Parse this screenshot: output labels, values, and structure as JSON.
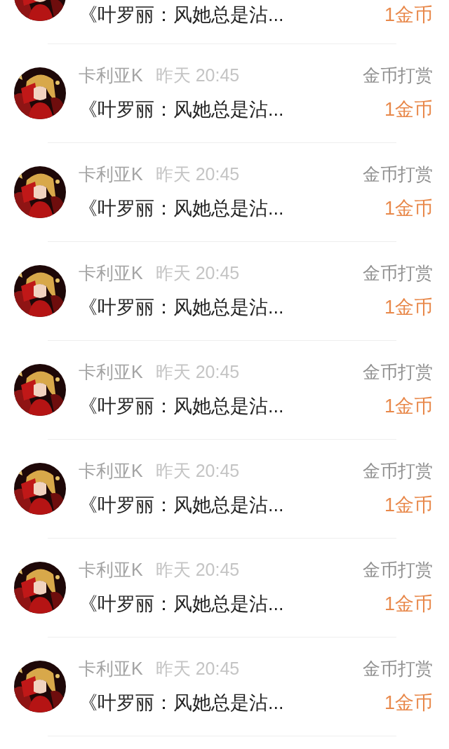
{
  "messages": [
    {
      "title": "《叶罗丽：风她总是沾...",
      "reward": "1金币"
    },
    {
      "sender": "卡利亚K",
      "time": "昨天 20:45",
      "type_label": "金币打赏",
      "title": "《叶罗丽：风她总是沾...",
      "reward": "1金币"
    },
    {
      "sender": "卡利亚K",
      "time": "昨天 20:45",
      "type_label": "金币打赏",
      "title": "《叶罗丽：风她总是沾...",
      "reward": "1金币"
    },
    {
      "sender": "卡利亚K",
      "time": "昨天 20:45",
      "type_label": "金币打赏",
      "title": "《叶罗丽：风她总是沾...",
      "reward": "1金币"
    },
    {
      "sender": "卡利亚K",
      "time": "昨天 20:45",
      "type_label": "金币打赏",
      "title": "《叶罗丽：风她总是沾...",
      "reward": "1金币"
    },
    {
      "sender": "卡利亚K",
      "time": "昨天 20:45",
      "type_label": "金币打赏",
      "title": "《叶罗丽：风她总是沾...",
      "reward": "1金币"
    },
    {
      "sender": "卡利亚K",
      "time": "昨天 20:45",
      "type_label": "金币打赏",
      "title": "《叶罗丽：风她总是沾...",
      "reward": "1金币"
    },
    {
      "sender": "卡利亚K",
      "time": "昨天 20:45",
      "type_label": "金币打赏",
      "title": "《叶罗丽：风她总是沾...",
      "reward": "1金币"
    }
  ]
}
